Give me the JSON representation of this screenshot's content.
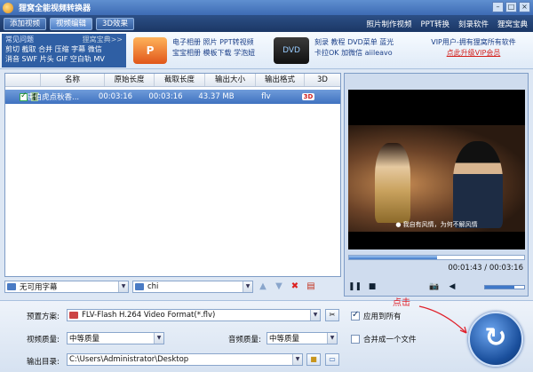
{
  "app": {
    "title": "狸窝全能视频转换器"
  },
  "toolbar": {
    "buttons": [
      "添加视频",
      "视频编辑",
      "3D效果"
    ],
    "links": [
      "照片制作视频",
      "PPT转换",
      "刻录软件",
      "狸窝宝典"
    ]
  },
  "banner": {
    "faq_title": "常见问题",
    "faq_more": "狸窝宝典>>",
    "faq_line1": "剪切 截取 合并 压缩 字幕 微信",
    "faq_line2": "消音 SWF 片头 GIF 空白轨 MV",
    "ppt_badge": "P",
    "promo1_line1": "电子相册 照片 PPT转视频",
    "promo1_line2": "宝宝相册 模板下载 学泡妞",
    "dvd_badge": "DVD",
    "promo2_line1": "刻录 教程 DVD菜单 蓝光",
    "promo2_line2": "卡拉OK 加微信 aiileavo",
    "vip_text": "VIP用户-拥有狸窝所有软件",
    "vip_link": "点此升级VIP会员"
  },
  "file_table": {
    "columns": [
      "",
      "名称",
      "原始长度",
      "截取长度",
      "输出大小",
      "输出格式",
      "3D"
    ],
    "rows": [
      {
        "name": "唐伯虎点秋香...",
        "original_length": "00:03:16",
        "trim_length": "00:03:16",
        "output_size": "43.37 MB",
        "output_format": "flv",
        "three_d": "3D",
        "checked": true
      }
    ]
  },
  "subtitle_bar": {
    "subtitle_select": "无可用字幕",
    "audio_select": "chi"
  },
  "preview": {
    "video_subtitle": "● 我自有风情，为何不解风情",
    "progress": 0.5,
    "current_time": "00:01:43",
    "total_time": "00:03:16",
    "volume": 0.75
  },
  "settings": {
    "preset_label": "预置方案:",
    "preset_value": "FLV-Flash H.264 Video Format(*.flv)",
    "apply_all_label": "应用到所有",
    "apply_all_checked": true,
    "video_quality_label": "视频质量:",
    "video_quality_value": "中等质量",
    "audio_quality_label": "音频质量:",
    "audio_quality_value": "中等质量",
    "merge_label": "合并成一个文件",
    "merge_checked": false,
    "output_dir_label": "输出目录:",
    "output_dir_value": "C:\\Users\\Administrator\\Desktop"
  },
  "annotation": {
    "click_note": "点击"
  },
  "colors": {
    "accent": "#3f72c0",
    "annotation": "#e0202a"
  }
}
